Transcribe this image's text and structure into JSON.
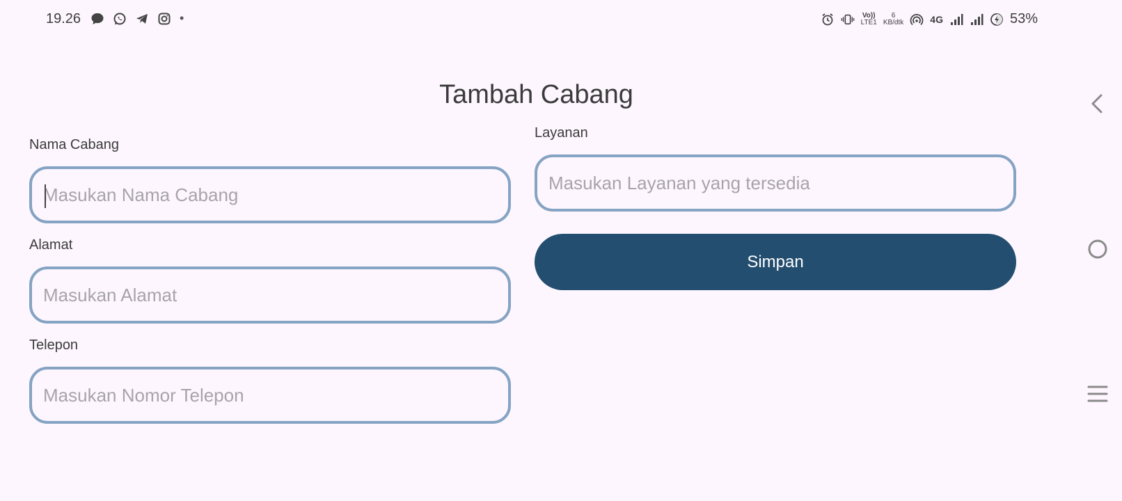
{
  "status_bar": {
    "time": "19.26",
    "dot": "•",
    "volte_line1": "Vo))",
    "volte_line2": "LTE1",
    "net_speed_value": "6",
    "net_speed_unit": "KB/dtk",
    "network_type": "4G",
    "battery": "53%",
    "icons_left": [
      "chat-bubble-icon",
      "whatsapp-icon",
      "telegram-icon",
      "instagram-icon"
    ],
    "icons_right": [
      "alarm-icon",
      "vibrate-icon",
      "hotspot-icon",
      "signal-icon",
      "signal-icon",
      "battery-charging-icon"
    ]
  },
  "page": {
    "title": "Tambah Cabang"
  },
  "form": {
    "nama_cabang": {
      "label": "Nama Cabang",
      "placeholder": "Masukan Nama Cabang",
      "value": ""
    },
    "alamat": {
      "label": "Alamat",
      "placeholder": "Masukan Alamat",
      "value": ""
    },
    "telepon": {
      "label": "Telepon",
      "placeholder": "Masukan Nomor Telepon",
      "value": ""
    },
    "layanan": {
      "label": "Layanan",
      "placeholder": "Masukan Layanan yang tersedia",
      "value": ""
    },
    "save_label": "Simpan"
  },
  "colors": {
    "background": "#fdf6fe",
    "field_border": "#85a3c2",
    "button": "#244e70",
    "button_text": "#ffffff",
    "placeholder": "#a7a4a9"
  },
  "nav_bar": {
    "icons": [
      "back-icon",
      "home-icon",
      "recents-icon"
    ]
  }
}
